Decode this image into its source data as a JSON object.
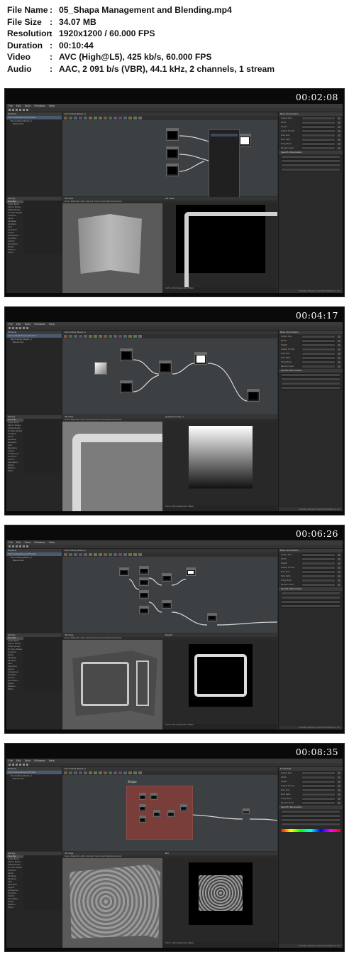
{
  "file_info": [
    {
      "key": "File Name",
      "value": "05_Shapa Management and Blending.mp4"
    },
    {
      "key": "File Size",
      "value": "34.07 MB"
    },
    {
      "key": "Resolution",
      "value": "1920x1200 / 60.000 FPS"
    },
    {
      "key": "Duration",
      "value": "00:10:44"
    },
    {
      "key": "Video",
      "value": "AVC (High@L5), 425 kb/s, 60.000 FPS"
    },
    {
      "key": "Audio",
      "value": "AAC, 2 091 b/s (VBR), 44.1 kHz, 2 channels, 1 stream"
    }
  ],
  "separator": ":",
  "menu": [
    "File",
    "Edit",
    "Tools",
    "Windows",
    "Help"
  ],
  "frames": [
    {
      "timestamp": "00:02:08",
      "graph_tab": "Decorative_Bevel_4",
      "view2d_tab": "2D View",
      "props_title": "Base Parameters"
    },
    {
      "timestamp": "00:04:17",
      "graph_tab": "Decorative_Bevel_4",
      "view2d_tab": "gradient_linear_1",
      "props_title": "Base Parameters"
    },
    {
      "timestamp": "00:06:26",
      "graph_tab": "Decorative_Bevel_4",
      "view2d_tab": "Height",
      "props_title": "Base Parameters"
    },
    {
      "timestamp": "00:08:35",
      "graph_tab": "Decorative_Bevel_4",
      "view2d_tab": "Bkr",
      "props_title": "Properties"
    }
  ],
  "explorer": {
    "title": "Explorer",
    "items": [
      "Decorative Bevel_PH.sbs*",
      "Decorative_Bevel_4",
      "Resources"
    ]
  },
  "library": {
    "title": "Library",
    "items": [
      "Favorites",
      "Graph Items",
      "Atomic Nodes",
      "FxMap Nodes",
      "Function Nodes",
      "Constant",
      "Vector",
      "Variables",
      "Samplers",
      "Cast",
      "Operators",
      "Logical",
      "Comparison",
      "Functions",
      "Control",
      "Generators",
      "Noises",
      "Patterns",
      "Filters"
    ]
  },
  "view3d": {
    "title": "3D View",
    "menu": "Scene  Materials  Lights  Camera  Environment  Display  Renderer"
  },
  "view2d_footer": "1024 x 1024 (Grayscale, 16bpc)",
  "props": {
    "sections": [
      "Base Parameters",
      "Specific Parameters"
    ],
    "rows": [
      "Output Size",
      "Width",
      "Height",
      "Output Format",
      "Pixel Size",
      "Pixel Ratio",
      "Tiling Mode",
      "Random Seed"
    ]
  },
  "status": "Substance Engine: Direct3D 10  Memory: 1%",
  "shape_label": "Shape"
}
